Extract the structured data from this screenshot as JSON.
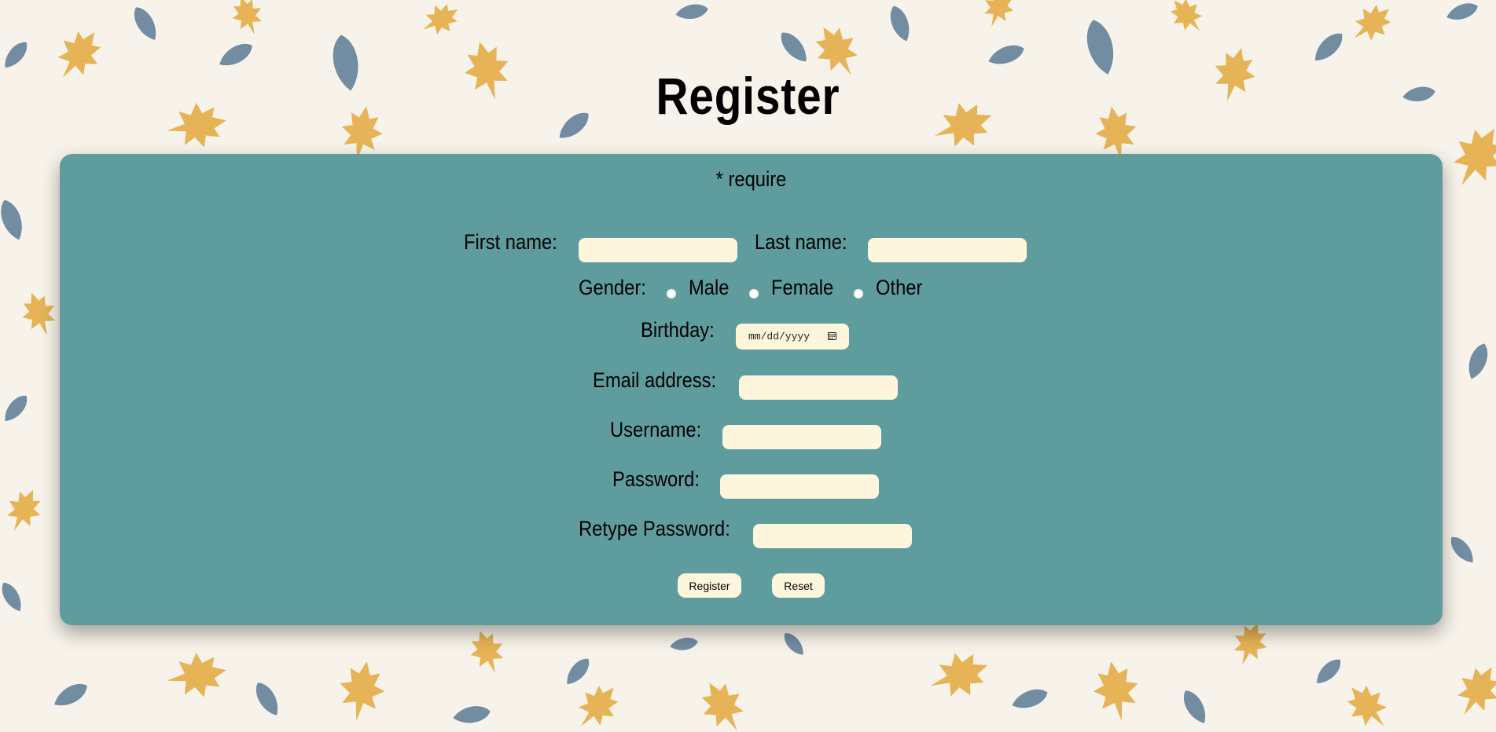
{
  "page": {
    "title": "Register",
    "required_note": "* require"
  },
  "form": {
    "first_name_label": "First name:",
    "last_name_label": "Last name:",
    "first_name_value": "",
    "last_name_value": "",
    "gender_label": "Gender:",
    "gender_options": [
      "Male",
      "Female",
      "Other"
    ],
    "gender_selected": "",
    "birthday_label": "Birthday:",
    "birthday_placeholder": "mm/dd/yyyy",
    "email_label": "Email address:",
    "email_value": "",
    "username_label": "Username:",
    "username_value": "",
    "password_label": "Password:",
    "password_value": "",
    "retype_password_label": "Retype Password:",
    "retype_password_value": "",
    "register_button": "Register",
    "reset_button": "Reset",
    "date_picker_icon": "calendar-icon"
  },
  "colors": {
    "card_background": "#5f9c9e",
    "field_background": "#fdf5dc",
    "page_background": "#f7f3ea",
    "leaf_orange": "#e3a83c",
    "leaf_blue": "#5a7a95"
  }
}
